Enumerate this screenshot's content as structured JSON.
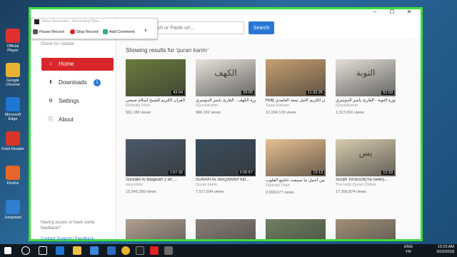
{
  "desktop": {
    "icons": [
      {
        "name": "official-player-icon",
        "label": "Official Player",
        "color": "#e03030"
      },
      {
        "name": "chrome-icon",
        "label": "Google Chrome",
        "color": "#e8b330"
      },
      {
        "name": "edge-icon",
        "label": "Microsoft Edge",
        "color": "#1e76d4"
      },
      {
        "name": "foxit-icon",
        "label": "Foxit Reader",
        "color": "#d8352a"
      },
      {
        "name": "firefox-icon",
        "label": "Firefox",
        "color": "#e8662a"
      },
      {
        "name": "jumpstart-icon",
        "label": "Jumpstart",
        "color": "#2f7fd0"
      }
    ]
  },
  "steps_recorder": {
    "title": "Steps Recorder - Recording Now",
    "pause": "Pause Record",
    "stop": "Stop Record",
    "add_comment": "Add Comment",
    "help": "?"
  },
  "sidebar": {
    "check_update": "Check for Update",
    "items": [
      {
        "label": "Home",
        "icon": "home-icon",
        "glyph": "⌂"
      },
      {
        "label": "Downloads",
        "icon": "download-icon",
        "glyph": "⬇",
        "badge": "1"
      },
      {
        "label": "Settings",
        "icon": "gear-icon",
        "glyph": "⚙"
      },
      {
        "label": "About",
        "icon": "info-icon",
        "glyph": "ⓘ"
      }
    ],
    "help_text": "Having issues or have some feedback?",
    "contact": "Contact Support | Feedback"
  },
  "search": {
    "placeholder": "Search or Paste url...",
    "button": "Search"
  },
  "results": {
    "prefix": "Showing results for ",
    "query": "'quran karim'"
  },
  "videos": [
    {
      "title": "تلاوة القرآن الكريم للشيخ اسلام صبحي",
      "channel": "Ghibokk Filah",
      "views": "561,166 views",
      "duration": "43:04",
      "bg": "#6a7c3c",
      "label": ""
    },
    {
      "title": "سورة الكهف - القارئ ياسر الدوسري",
      "channel": "IQuranKarim",
      "views": "986,192 views",
      "duration": "29:05",
      "bg": "#e8e4dc",
      "label": "الكهف"
    },
    {
      "title": "Holy القرآن الكريم كامل سعد الغامدي",
      "channel": "Saad Hisham",
      "views": "12,264,129 views",
      "duration": "11:32:25",
      "bg": "#c8a070",
      "label": ""
    },
    {
      "title": "سورة التوبة - القارئ ياسر الدوسري",
      "channel": "IQuranKarim",
      "views": "1,317,650 views",
      "duration": "52:03",
      "bg": "#e4e0d8",
      "label": "التوبة"
    },
    {
      "title": "Sourate Al Baqarah 2 en ...",
      "channel": "nourislam",
      "views": "15,549,290 views",
      "duration": "1:57:32",
      "bg": "#4a5a6a",
      "label": ""
    },
    {
      "title": "SURAH AL BAQARAH full...",
      "channel": "Quran karim",
      "views": "7,517,594 views",
      "duration": "2:05:57",
      "bg": "#3a4e5e",
      "label": ""
    },
    {
      "title": "تلاوة من أجمل ما سمعت خاشع القلوب",
      "channel": "Ghibokk Filah",
      "views": "2,658,677 views",
      "duration": "13:13",
      "bg": "#e8c090",
      "label": ""
    },
    {
      "title": "Surah YASEEN(Ya-Seen)...",
      "channel": "The Holy Quran Online",
      "views": "17,356,874 views",
      "duration": "12:33",
      "bg": "#d8ccb0",
      "label": "يس"
    },
    {
      "title": "",
      "channel": "",
      "views": "",
      "duration": "",
      "bg": "#b0a090",
      "label": ""
    },
    {
      "title": "",
      "channel": "",
      "views": "",
      "duration": "",
      "bg": "#8a8078",
      "label": ""
    },
    {
      "title": "",
      "channel": "",
      "views": "",
      "duration": "",
      "bg": "#708060",
      "label": ""
    },
    {
      "title": "",
      "channel": "",
      "views": "",
      "duration": "",
      "bg": "#a09078",
      "label": ""
    }
  ],
  "taskbar": {
    "lang_top": "ENG",
    "lang_bottom": "FR",
    "time": "10:23 AM",
    "date": "9/16/2018"
  }
}
